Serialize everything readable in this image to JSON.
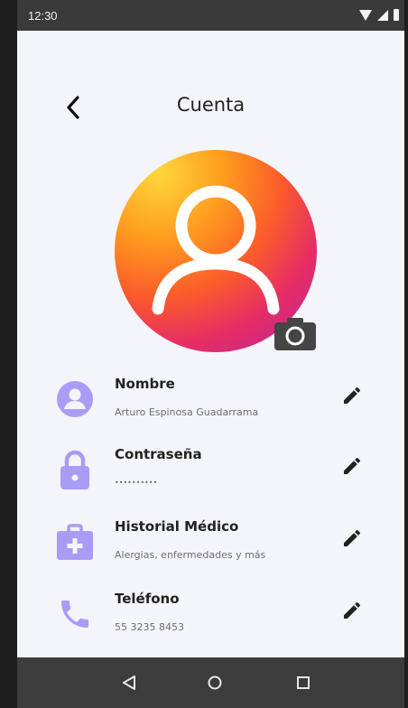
{
  "status_bar": {
    "time": "12:30"
  },
  "header": {
    "title": "Cuenta",
    "back_icon": "chevron-left-icon"
  },
  "profile": {
    "avatar_icon": "user-icon",
    "camera_icon": "camera-icon"
  },
  "fields": [
    {
      "label": "Nombre",
      "value": "Arturo Espinosa Guadarrama",
      "icon": "person-circle-icon"
    },
    {
      "label": "Contraseña",
      "value": "••••••••••",
      "icon": "lock-icon"
    },
    {
      "label": "Historial Médico",
      "value": "Alergias, enfermedades y más",
      "icon": "medical-kit-icon"
    },
    {
      "label": "Teléfono",
      "value": "55 3235 8453",
      "icon": "phone-icon"
    }
  ],
  "colors": {
    "background": "#f4f4fb",
    "icon_purple": "#a99cf5",
    "text_dark": "#222222",
    "text_muted": "#6f6f6f",
    "avatar_gradient": [
      "#ffd73a",
      "#fb5a2c",
      "#e62d64",
      "#b8239f"
    ]
  }
}
